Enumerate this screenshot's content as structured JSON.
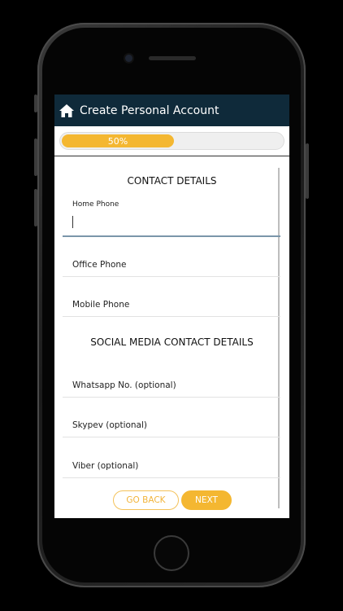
{
  "header": {
    "title": "Create Personal Account"
  },
  "progress": {
    "label": "50%",
    "value": 0.5
  },
  "sections": {
    "contact": "CONTACT DETAILS",
    "social": "SOCIAL MEDIA CONTACT DETAILS"
  },
  "fields": {
    "home_phone": {
      "label": "Home Phone",
      "value": ""
    },
    "office_phone": {
      "label": "Office Phone"
    },
    "mobile_phone": {
      "label": "Mobile Phone"
    },
    "whatsapp": {
      "label": "Whatsapp No. (optional)"
    },
    "skype": {
      "label": "Skypev (optional)"
    },
    "viber": {
      "label": "Viber (optional)"
    }
  },
  "buttons": {
    "back": "GO BACK",
    "next": "NEXT"
  },
  "colors": {
    "header_bg": "#0f2a3a",
    "accent": "#f4b731",
    "active_underline": "#7b96aa"
  }
}
